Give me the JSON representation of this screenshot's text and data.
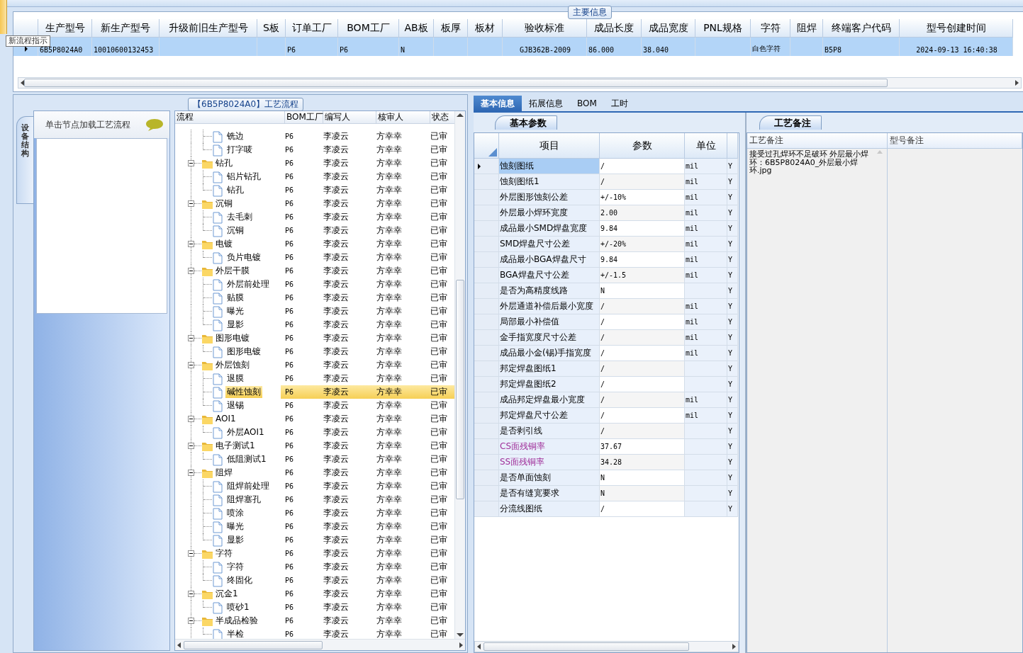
{
  "tooltip": "新流程指示",
  "main_info": {
    "title": "主要信息",
    "columns": [
      "生产型号",
      "新生产型号",
      "升级前旧生产型号",
      "S板",
      "订单工厂",
      "BOM工厂",
      "AB板",
      "板厚",
      "板材",
      "验收标准",
      "成品长度",
      "成品宽度",
      "PNL规格",
      "字符",
      "阻焊",
      "终端客户代码",
      "型号创建时间"
    ],
    "rows": [
      {
        "selected": true,
        "cells": [
          "6B5P8024A0",
          "10010600132453",
          null,
          null,
          "P6",
          "P6",
          "N",
          null,
          null,
          "GJB362B-2009",
          "86.000",
          "38.040",
          null,
          "白色字符",
          null,
          "B5P8",
          "2024-09-13 16:40:38"
        ]
      }
    ]
  },
  "process_flow": {
    "title": "【6B5P8024A0】工艺流程",
    "side_tab": {
      "label": "设备结构",
      "selected": true
    },
    "hint": "单击节点加载工艺流程",
    "columns": [
      "流程",
      "BOM工厂",
      "编写人",
      "核审人",
      "状态"
    ],
    "nodes": [
      {
        "children": [
          {
            "label": "铣边",
            "bom": "P6",
            "writer": "李凌云",
            "reviewer": "方幸幸",
            "status": "已审",
            "selected": false
          },
          {
            "label": "打字唛",
            "bom": "P6",
            "writer": "李凌云",
            "reviewer": "方幸幸",
            "status": "已审",
            "selected": false
          }
        ]
      },
      {
        "label": "钻孔",
        "bom": "P6",
        "writer": "李凌云",
        "reviewer": "方幸幸",
        "status": "已审",
        "selected": false,
        "expanded": true,
        "children": [
          {
            "label": "铝片钻孔",
            "bom": "P6",
            "writer": "李凌云",
            "reviewer": "方幸幸",
            "status": "已审",
            "selected": false
          },
          {
            "label": "钻孔",
            "bom": "P6",
            "writer": "李凌云",
            "reviewer": "方幸幸",
            "status": "已审",
            "selected": false
          }
        ]
      },
      {
        "label": "沉铜",
        "bom": "P6",
        "writer": "李凌云",
        "reviewer": "方幸幸",
        "status": "已审",
        "selected": false,
        "expanded": true,
        "children": [
          {
            "label": "去毛刺",
            "bom": "P6",
            "writer": "李凌云",
            "reviewer": "方幸幸",
            "status": "已审",
            "selected": false
          },
          {
            "label": "沉铜",
            "bom": "P6",
            "writer": "李凌云",
            "reviewer": "方幸幸",
            "status": "已审",
            "selected": false
          }
        ]
      },
      {
        "label": "电镀",
        "bom": "P6",
        "writer": "李凌云",
        "reviewer": "方幸幸",
        "status": "已审",
        "selected": false,
        "expanded": true,
        "children": [
          {
            "label": "负片电镀",
            "bom": "P6",
            "writer": "李凌云",
            "reviewer": "方幸幸",
            "status": "已审",
            "selected": false
          }
        ]
      },
      {
        "label": "外层干膜",
        "bom": "P6",
        "writer": "李凌云",
        "reviewer": "方幸幸",
        "status": "已审",
        "selected": false,
        "expanded": true,
        "children": [
          {
            "label": "外层前处理",
            "bom": "P6",
            "writer": "李凌云",
            "reviewer": "方幸幸",
            "status": "已审",
            "selected": false
          },
          {
            "label": "贴膜",
            "bom": "P6",
            "writer": "李凌云",
            "reviewer": "方幸幸",
            "status": "已审",
            "selected": false
          },
          {
            "label": "曝光",
            "bom": "P6",
            "writer": "李凌云",
            "reviewer": "方幸幸",
            "status": "已审",
            "selected": false
          },
          {
            "label": "显影",
            "bom": "P6",
            "writer": "李凌云",
            "reviewer": "方幸幸",
            "status": "已审",
            "selected": false
          }
        ]
      },
      {
        "label": "图形电镀",
        "bom": "P6",
        "writer": "李凌云",
        "reviewer": "方幸幸",
        "status": "已审",
        "selected": false,
        "expanded": true,
        "children": [
          {
            "label": "图形电镀",
            "bom": "P6",
            "writer": "李凌云",
            "reviewer": "方幸幸",
            "status": "已审",
            "selected": false
          }
        ]
      },
      {
        "label": "外层蚀刻",
        "bom": "P6",
        "writer": "李凌云",
        "reviewer": "方幸幸",
        "status": "已审",
        "selected": false,
        "expanded": true,
        "children": [
          {
            "label": "退膜",
            "bom": "P6",
            "writer": "李凌云",
            "reviewer": "方幸幸",
            "status": "已审",
            "selected": false
          },
          {
            "label": "碱性蚀刻",
            "bom": "P6",
            "writer": "李凌云",
            "reviewer": "方幸幸",
            "status": "已审",
            "selected": true
          },
          {
            "label": "退锡",
            "bom": "P6",
            "writer": "李凌云",
            "reviewer": "方幸幸",
            "status": "已审",
            "selected": false
          }
        ]
      },
      {
        "label": "AOI1",
        "bom": "P6",
        "writer": "李凌云",
        "reviewer": "方幸幸",
        "status": "已审",
        "selected": false,
        "expanded": true,
        "children": [
          {
            "label": "外层AOI1",
            "bom": "P6",
            "writer": "李凌云",
            "reviewer": "方幸幸",
            "status": "已审",
            "selected": false
          }
        ]
      },
      {
        "label": "电子测试1",
        "bom": "P6",
        "writer": "李凌云",
        "reviewer": "方幸幸",
        "status": "已审",
        "selected": false,
        "expanded": true,
        "children": [
          {
            "label": "低阻测试1",
            "bom": "P6",
            "writer": "李凌云",
            "reviewer": "方幸幸",
            "status": "已审",
            "selected": false
          }
        ]
      },
      {
        "label": "阻焊",
        "bom": "P6",
        "writer": "李凌云",
        "reviewer": "方幸幸",
        "status": "已审",
        "selected": false,
        "expanded": true,
        "children": [
          {
            "label": "阻焊前处理",
            "bom": "P6",
            "writer": "李凌云",
            "reviewer": "方幸幸",
            "status": "已审",
            "selected": false
          },
          {
            "label": "阻焊塞孔",
            "bom": "P6",
            "writer": "李凌云",
            "reviewer": "方幸幸",
            "status": "已审",
            "selected": false
          },
          {
            "label": "喷涂",
            "bom": "P6",
            "writer": "李凌云",
            "reviewer": "方幸幸",
            "status": "已审",
            "selected": false
          },
          {
            "label": "曝光",
            "bom": "P6",
            "writer": "李凌云",
            "reviewer": "方幸幸",
            "status": "已审",
            "selected": false
          },
          {
            "label": "显影",
            "bom": "P6",
            "writer": "李凌云",
            "reviewer": "方幸幸",
            "status": "已审",
            "selected": false
          }
        ]
      },
      {
        "label": "字符",
        "bom": "P6",
        "writer": "李凌云",
        "reviewer": "方幸幸",
        "status": "已审",
        "selected": false,
        "expanded": true,
        "children": [
          {
            "label": "字符",
            "bom": "P6",
            "writer": "李凌云",
            "reviewer": "方幸幸",
            "status": "已审",
            "selected": false
          },
          {
            "label": "终固化",
            "bom": "P6",
            "writer": "李凌云",
            "reviewer": "方幸幸",
            "status": "已审",
            "selected": false
          }
        ]
      },
      {
        "label": "沉金1",
        "bom": "P6",
        "writer": "李凌云",
        "reviewer": "方幸幸",
        "status": "已审",
        "selected": false,
        "expanded": true,
        "children": [
          {
            "label": "喷砂1",
            "bom": "P6",
            "writer": "李凌云",
            "reviewer": "方幸幸",
            "status": "已审",
            "selected": false
          }
        ]
      },
      {
        "label": "半成品检验",
        "bom": "P6",
        "writer": "李凌云",
        "reviewer": "方幸幸",
        "status": "已审",
        "selected": false,
        "expanded": true,
        "children": [
          {
            "label": "半检",
            "bom": "P6",
            "writer": "李凌云",
            "reviewer": "方幸幸",
            "status": "已审",
            "selected": false
          }
        ]
      }
    ]
  },
  "tabs": [
    {
      "label": "基本信息",
      "selected": true
    },
    {
      "label": "拓展信息",
      "selected": false
    },
    {
      "label": "BOM",
      "selected": false
    },
    {
      "label": "工时",
      "selected": false
    }
  ],
  "basic_params": {
    "title": "基本参数",
    "columns": [
      "项目",
      "参数",
      "单位"
    ],
    "rows": [
      {
        "item": "蚀刻图纸",
        "value": "/",
        "unit": "mil",
        "column_5": "Y",
        "selected": true
      },
      {
        "item": "蚀刻图纸1",
        "value": "/",
        "unit": "mil",
        "column_5": "Y",
        "selected": false
      },
      {
        "item": "外层图形蚀刻公差",
        "value": "+/-10%",
        "unit": "mil",
        "column_5": "Y",
        "selected": false
      },
      {
        "item": "外层最小焊环宽度",
        "value": "2.00",
        "unit": "mil",
        "column_5": "Y",
        "selected": false
      },
      {
        "item": "成品最小SMD焊盘宽度",
        "value": "9.84",
        "unit": "mil",
        "column_5": "Y",
        "selected": false
      },
      {
        "item": "SMD焊盘尺寸公差",
        "value": "+/-20%",
        "unit": "mil",
        "column_5": "Y",
        "selected": false
      },
      {
        "item": "成品最小BGA焊盘尺寸",
        "value": "9.84",
        "unit": "mil",
        "column_5": "Y",
        "selected": false
      },
      {
        "item": "BGA焊盘尺寸公差",
        "value": "+/-1.5",
        "unit": "mil",
        "column_5": "Y",
        "selected": false
      },
      {
        "item": "是否为高精度线路",
        "value": "N",
        "column_5": "Y",
        "selected": false
      },
      {
        "item": "外层通道补偿后最小宽度",
        "value": "/",
        "unit": "mil",
        "column_5": "Y",
        "selected": false
      },
      {
        "item": "局部最小补偿值",
        "value": "/",
        "unit": "mil",
        "column_5": "Y",
        "selected": false
      },
      {
        "item": "金手指宽度尺寸公差",
        "value": "/",
        "unit": "mil",
        "column_5": "Y",
        "selected": false
      },
      {
        "item": "成品最小金(锡)手指宽度",
        "value": "/",
        "unit": "mil",
        "column_5": "Y",
        "selected": false
      },
      {
        "item": "邦定焊盘图纸1",
        "value": "/",
        "column_5": "Y",
        "selected": false
      },
      {
        "item": "邦定焊盘图纸2",
        "value": "/",
        "column_5": "Y",
        "selected": false
      },
      {
        "item": "成品邦定焊盘最小宽度",
        "value": "/",
        "unit": "mil",
        "column_5": "Y",
        "selected": false
      },
      {
        "item": "邦定焊盘尺寸公差",
        "value": "/",
        "unit": "mil",
        "column_5": "Y",
        "selected": false
      },
      {
        "item": "是否剥引线",
        "value": "/",
        "column_5": "Y",
        "selected": false
      },
      {
        "item": "CS面残铜率",
        "value": "37.67",
        "column_5": "Y",
        "color": "#a0309a",
        "selected": false
      },
      {
        "item": "SS面残铜率",
        "value": "34.28",
        "column_5": "Y",
        "color": "#a0309a",
        "selected": false
      },
      {
        "item": "是否单面蚀刻",
        "value": "N",
        "column_5": "Y",
        "selected": false
      },
      {
        "item": "是否有缝宽要求",
        "value": "N",
        "column_5": "Y",
        "selected": false
      },
      {
        "item": "分流线图纸",
        "value": "/",
        "column_5": "Y",
        "selected": false
      }
    ]
  },
  "process_notes": {
    "title": "工艺备注",
    "columns": [
      "工艺备注",
      "型号备注"
    ],
    "note": "接受过孔焊环不足破环 外层最小焊环：6B5P8024A0_外层最小焊环.jpg"
  }
}
